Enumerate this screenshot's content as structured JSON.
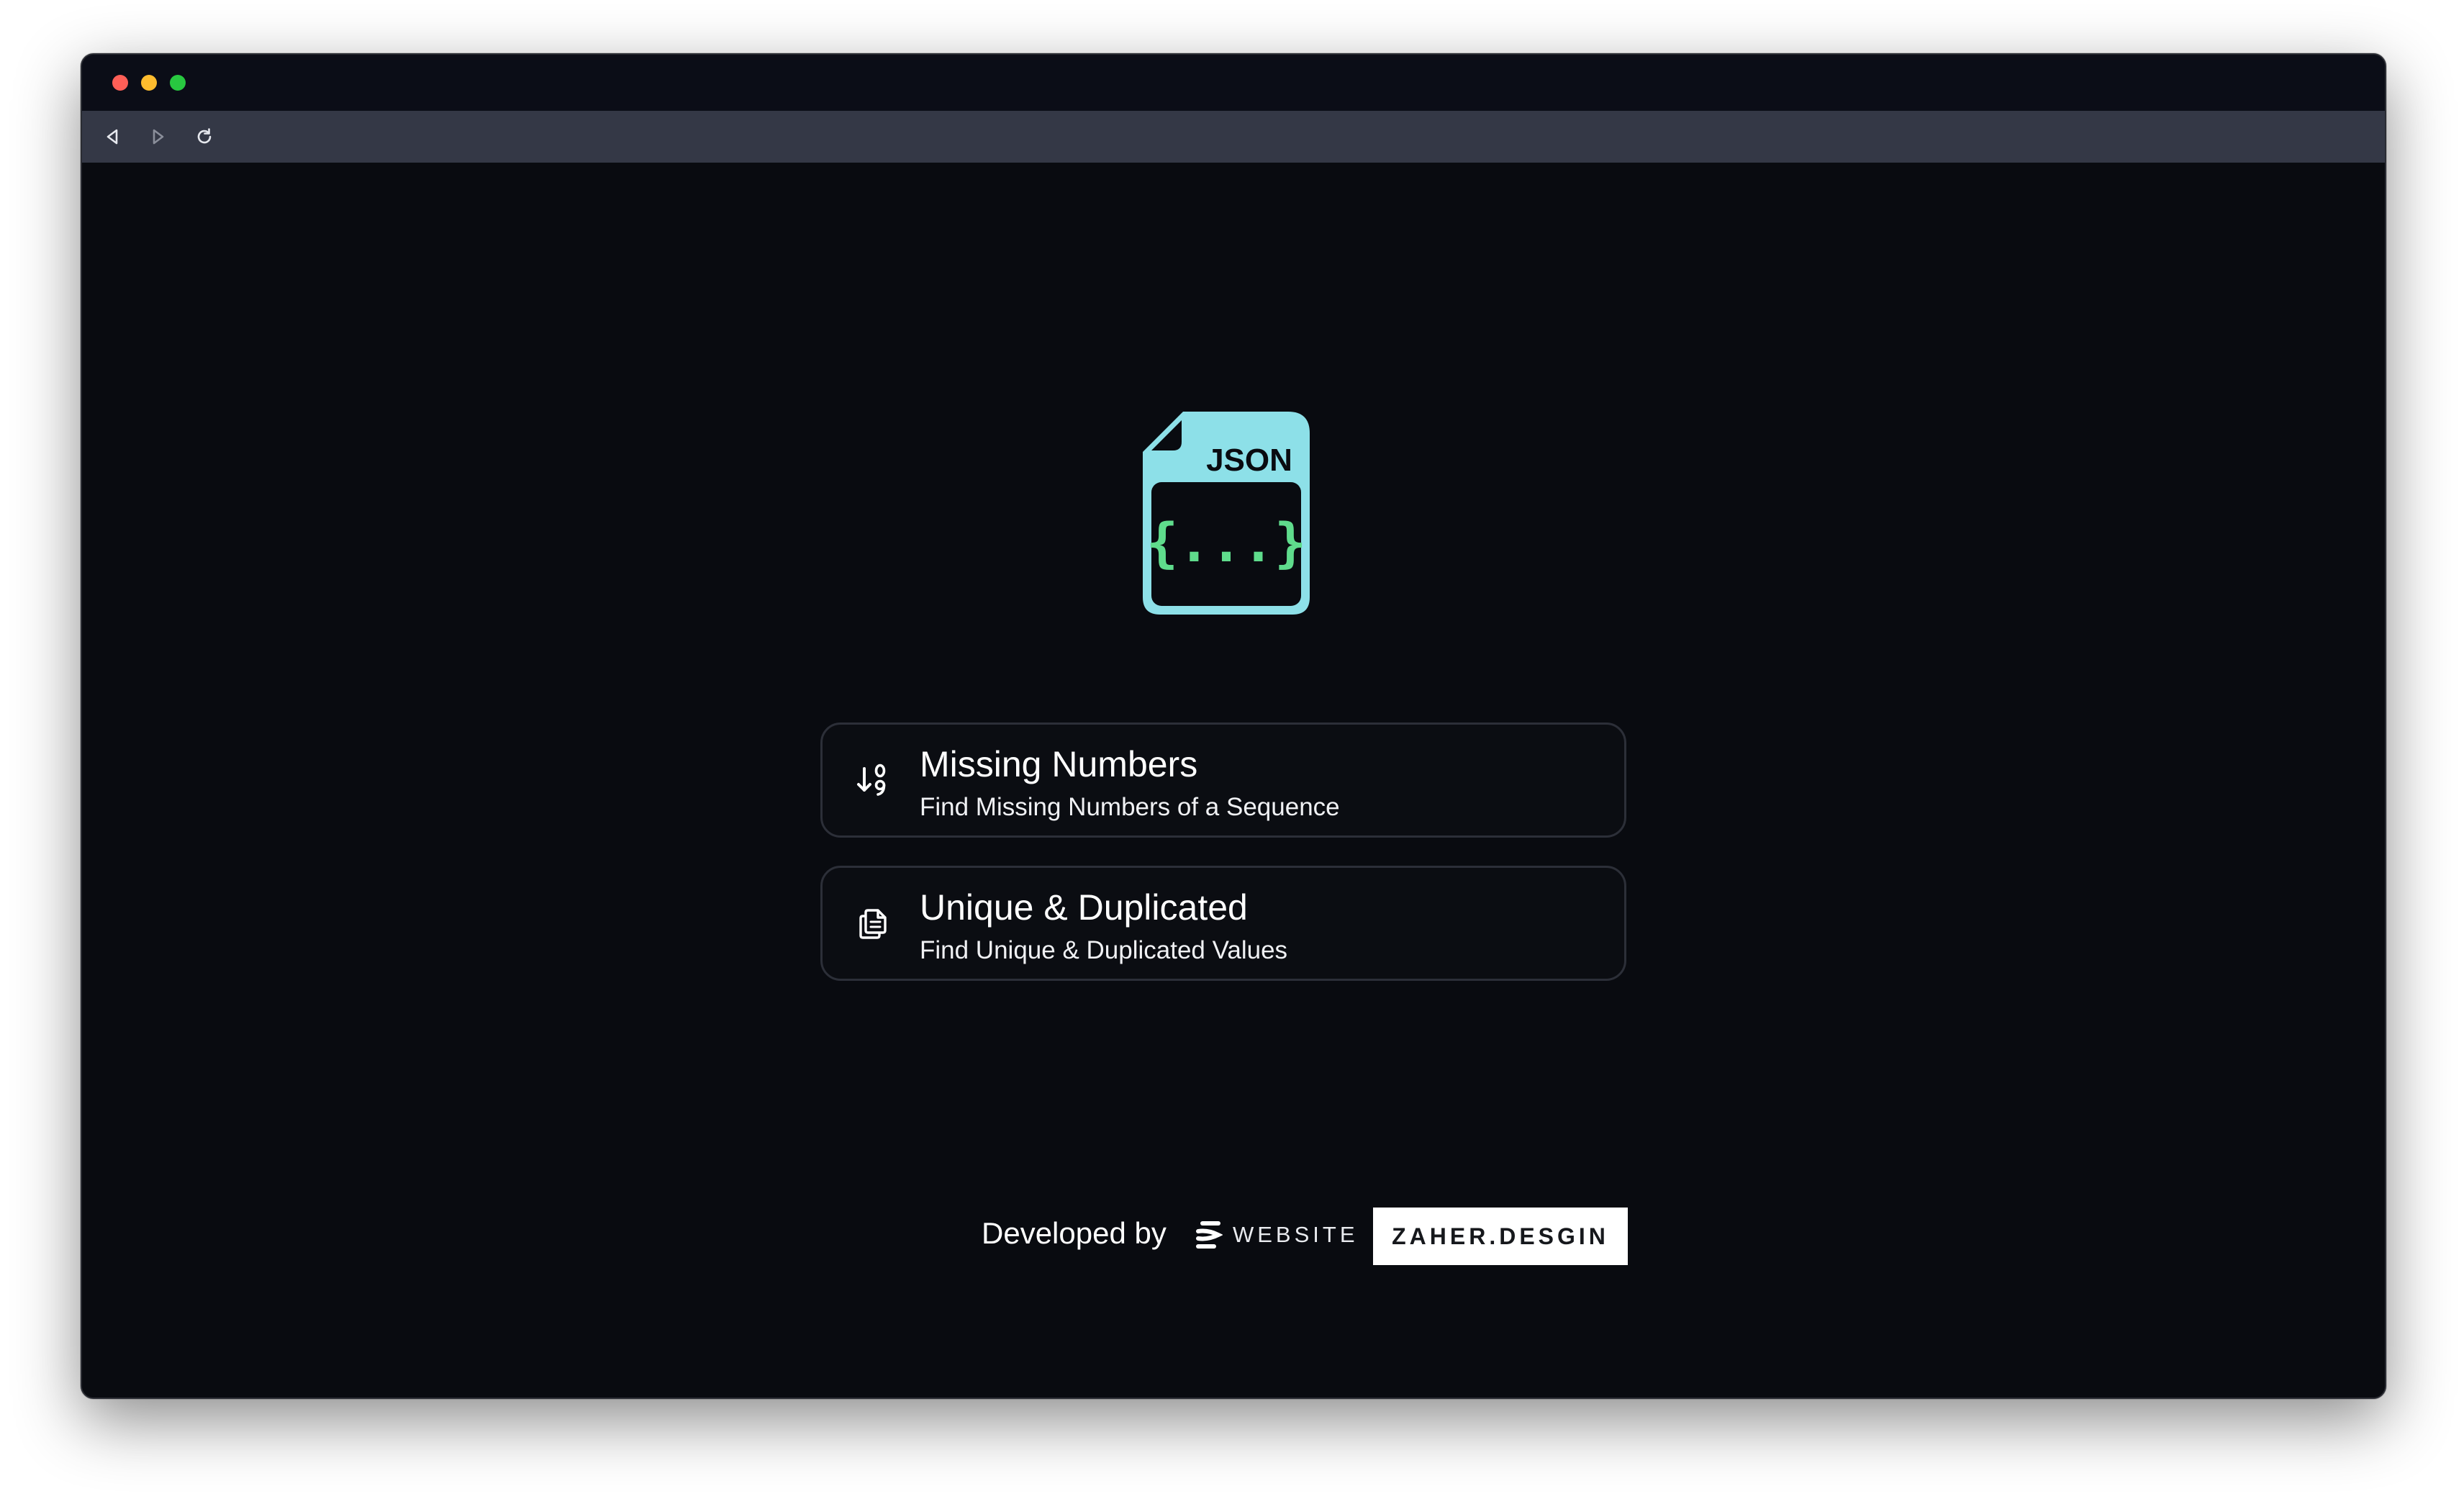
{
  "window": {
    "controls": {
      "close_color": "#ff5f57",
      "minimize_color": "#febc2e",
      "maximize_color": "#28c840"
    }
  },
  "toolbar": {
    "icons": [
      "back-icon",
      "forward-icon",
      "reload-icon"
    ]
  },
  "logo": {
    "label": "JSON",
    "glyph": "{...}",
    "primary_color": "#8de0e8",
    "accent_color": "#5fdc8c"
  },
  "tools": [
    {
      "title": "Missing Numbers",
      "subtitle": "Find Missing Numbers of a Sequence",
      "icon": "sort-numeric-down-icon"
    },
    {
      "title": "Unique & Duplicated",
      "subtitle": "Find Unique & Duplicated Values",
      "icon": "files-icon"
    }
  ],
  "footer": {
    "developed_by": "Developed by",
    "website_label": "WEBSITE",
    "brand": "ZAHER.DESGIN"
  },
  "colors": {
    "background": "#090b10",
    "card_border": "#2c2f38",
    "toolbar": "#343846",
    "titlebar": "#0b0d17"
  }
}
